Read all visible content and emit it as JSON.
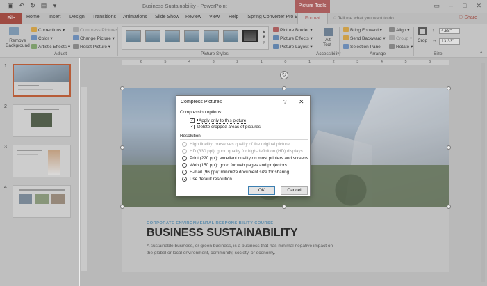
{
  "window": {
    "doc_title": "Business Sustainability  -  PowerPoint",
    "context_label": "Picture Tools"
  },
  "tabs": [
    "File",
    "Home",
    "Insert",
    "Design",
    "Transitions",
    "Animations",
    "Slide Show",
    "Review",
    "View",
    "Help",
    "iSpring Converter Pro 9",
    "Format"
  ],
  "tell_me": "Tell me what you want to do",
  "share": "Share",
  "ribbon": {
    "remove_bg_1": "Remove",
    "remove_bg_2": "Background",
    "corrections": "Corrections",
    "color": "Color",
    "artistic": "Artistic Effects",
    "compress": "Compress Pictures",
    "change": "Change Picture",
    "reset": "Reset Picture",
    "adjust_label": "Adjust",
    "border": "Picture Border",
    "effects": "Picture Effects",
    "layout": "Picture Layout",
    "styles_label": "Picture Styles",
    "alt_1": "Alt",
    "alt_2": "Text",
    "accessibility_label": "Accessibility",
    "bring_forward": "Bring Forward",
    "send_backward": "Send Backward",
    "selection_pane": "Selection Pane",
    "align": "Align",
    "group": "Group",
    "rotate": "Rotate",
    "arrange_label": "Arrange",
    "crop": "Crop",
    "height": "4.88\"",
    "width": "13.33\"",
    "size_label": "Size"
  },
  "slides": [
    "1",
    "2",
    "3",
    "4"
  ],
  "ruler_marks": [
    "6",
    "5",
    "4",
    "3",
    "2",
    "1",
    "0",
    "1",
    "2",
    "3",
    "4",
    "5",
    "6"
  ],
  "slide": {
    "subtitle": "CORPORATE ENVIRONMENTAL RESPONSIBILITY COURSE",
    "headline": "BUSINESS SUSTAINABILITY",
    "body": "A sustainable business, or green business, is a business that has minimal negative impact on the global or local environment, community, society, or economy."
  },
  "dialog": {
    "title": "Compress Pictures",
    "help": "?",
    "close": "✕",
    "compression_label": "Compression options:",
    "apply_only": "Apply only to this picture",
    "delete_cropped": "Delete cropped areas of pictures",
    "resolution_label": "Resolution:",
    "options": [
      "High fidelity: preserves quality of the original picture",
      "HD (330 ppi): good quality for high-definition (HD) displays",
      "Print (220 ppi): excellent quality on most printers and screens",
      "Web (150 ppi): good for web pages and projectors",
      "E-mail (96 ppi): minimize document size for sharing",
      "Use default resolution"
    ],
    "ok": "OK",
    "cancel": "Cancel"
  }
}
